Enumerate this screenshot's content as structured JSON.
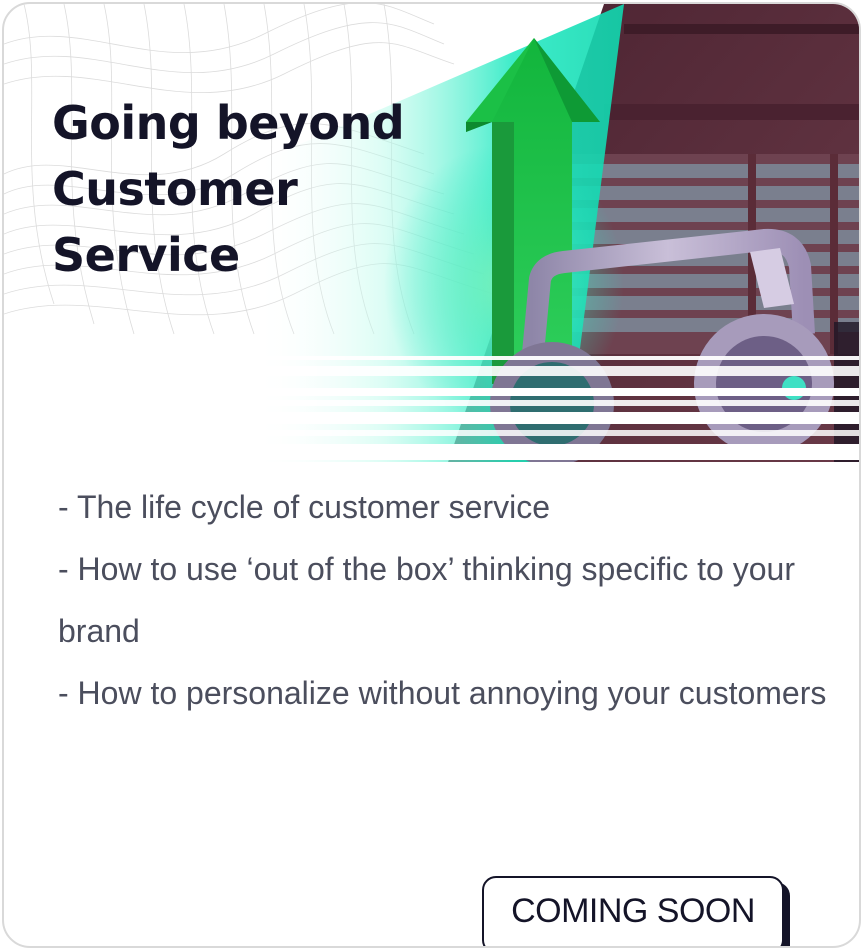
{
  "card": {
    "title": "Going beyond Customer Service",
    "bullets": [
      "- The life cycle of customer service",
      "- How to use ‘out of the box’ thinking specific to your brand",
      "- How to personalize without annoying your customers"
    ],
    "cta_label": "COMING SOON"
  },
  "hero_image": {
    "icon": "growth-arrow-with-shopping-cart-illustration",
    "colors": {
      "arrow_green": "#14a83a",
      "teal_glow": "#1de9c0",
      "background_maroon": "#5b2c38",
      "cart_lilac": "#b3a5c6",
      "title_ink": "#141428"
    }
  }
}
